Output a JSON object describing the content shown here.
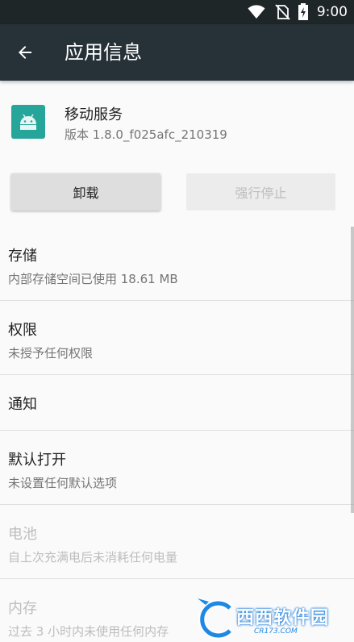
{
  "status_bar": {
    "time": "9:00"
  },
  "app_bar": {
    "title": "应用信息"
  },
  "app": {
    "name": "移动服务",
    "version": "版本 1.8.0_f025afc_210319"
  },
  "buttons": {
    "uninstall": "卸载",
    "force_stop": "强行停止"
  },
  "items": [
    {
      "title": "存储",
      "summary": "内部存储空间已使用 18.61 MB"
    },
    {
      "title": "权限",
      "summary": "未授予任何权限"
    },
    {
      "title": "通知"
    },
    {
      "title": "默认打开",
      "summary": "未设置任何默认选项"
    },
    {
      "title": "电池",
      "summary": "自上次充满电后未消耗任何电量"
    },
    {
      "title": "内存",
      "summary": "过去 3 小时内未使用任何内存"
    }
  ],
  "watermark": {
    "main": "西西软件园",
    "sub": "CR173.COM"
  },
  "colors": {
    "app_bar": "#263238",
    "status_bar": "#1f2628",
    "app_icon": "#26a69a"
  }
}
